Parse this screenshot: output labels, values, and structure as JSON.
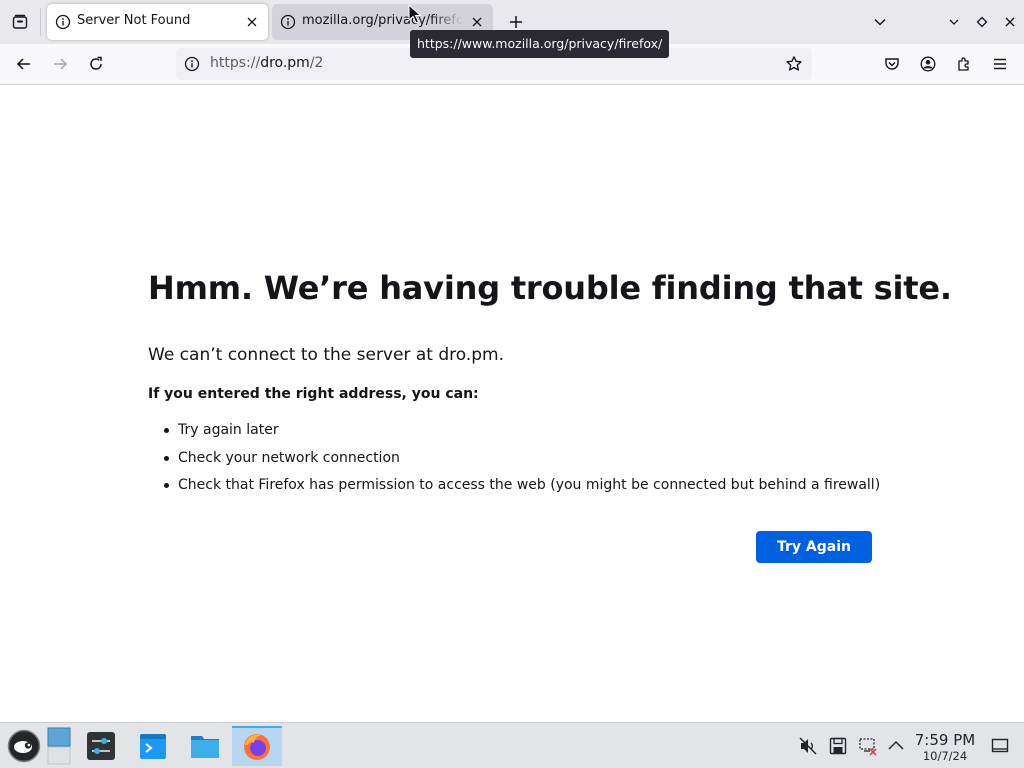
{
  "tabs": [
    {
      "title": "Server Not Found",
      "active": true
    },
    {
      "title": "mozilla.org/privacy/firefox/",
      "active": false
    }
  ],
  "tooltip": "https://www.mozilla.org/privacy/firefox/",
  "urlbar": {
    "scheme": "https://",
    "host": "dro.pm",
    "path": "/2"
  },
  "error": {
    "title": "Hmm. We’re having trouble finding that site.",
    "description": "We can’t connect to the server at dro.pm.",
    "subtitle": "If you entered the right address, you can:",
    "suggestions": [
      "Try again later",
      "Check your network connection",
      "Check that Firefox has permission to access the web (you might be connected but behind a firewall)"
    ],
    "button": "Try Again"
  },
  "taskbar": {
    "apps": [
      "application-launcher",
      "pager",
      "system-settings",
      "konsole",
      "file-manager",
      "firefox"
    ],
    "tray": [
      "audio-muted-icon",
      "save-icon",
      "network-disconnected-icon",
      "tray-expand-icon"
    ],
    "clock": {
      "time": "7:59 PM",
      "date": "10/7/24"
    }
  },
  "colors": {
    "accent": "#0061e0",
    "tabstrip": "#e9e9ed",
    "tooltip": "#2b2a33",
    "taskbar_active": "#b7d6f1"
  }
}
